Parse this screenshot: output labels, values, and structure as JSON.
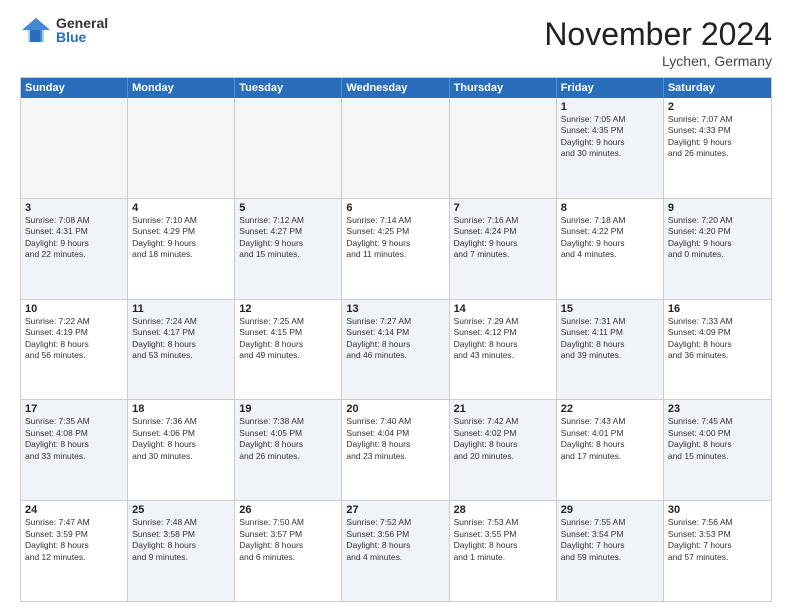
{
  "logo": {
    "general": "General",
    "blue": "Blue"
  },
  "title": "November 2024",
  "location": "Lychen, Germany",
  "days": [
    "Sunday",
    "Monday",
    "Tuesday",
    "Wednesday",
    "Thursday",
    "Friday",
    "Saturday"
  ],
  "rows": [
    [
      {
        "day": "",
        "text": "",
        "empty": true
      },
      {
        "day": "",
        "text": "",
        "empty": true
      },
      {
        "day": "",
        "text": "",
        "empty": true
      },
      {
        "day": "",
        "text": "",
        "empty": true
      },
      {
        "day": "",
        "text": "",
        "empty": true
      },
      {
        "day": "1",
        "text": "Sunrise: 7:05 AM\nSunset: 4:35 PM\nDaylight: 9 hours\nand 30 minutes.",
        "empty": false,
        "shaded": true
      },
      {
        "day": "2",
        "text": "Sunrise: 7:07 AM\nSunset: 4:33 PM\nDaylight: 9 hours\nand 26 minutes.",
        "empty": false,
        "shaded": false
      }
    ],
    [
      {
        "day": "3",
        "text": "Sunrise: 7:08 AM\nSunset: 4:31 PM\nDaylight: 9 hours\nand 22 minutes.",
        "empty": false,
        "shaded": true
      },
      {
        "day": "4",
        "text": "Sunrise: 7:10 AM\nSunset: 4:29 PM\nDaylight: 9 hours\nand 18 minutes.",
        "empty": false,
        "shaded": false
      },
      {
        "day": "5",
        "text": "Sunrise: 7:12 AM\nSunset: 4:27 PM\nDaylight: 9 hours\nand 15 minutes.",
        "empty": false,
        "shaded": true
      },
      {
        "day": "6",
        "text": "Sunrise: 7:14 AM\nSunset: 4:25 PM\nDaylight: 9 hours\nand 11 minutes.",
        "empty": false,
        "shaded": false
      },
      {
        "day": "7",
        "text": "Sunrise: 7:16 AM\nSunset: 4:24 PM\nDaylight: 9 hours\nand 7 minutes.",
        "empty": false,
        "shaded": true
      },
      {
        "day": "8",
        "text": "Sunrise: 7:18 AM\nSunset: 4:22 PM\nDaylight: 9 hours\nand 4 minutes.",
        "empty": false,
        "shaded": false
      },
      {
        "day": "9",
        "text": "Sunrise: 7:20 AM\nSunset: 4:20 PM\nDaylight: 9 hours\nand 0 minutes.",
        "empty": false,
        "shaded": true
      }
    ],
    [
      {
        "day": "10",
        "text": "Sunrise: 7:22 AM\nSunset: 4:19 PM\nDaylight: 8 hours\nand 56 minutes.",
        "empty": false,
        "shaded": false
      },
      {
        "day": "11",
        "text": "Sunrise: 7:24 AM\nSunset: 4:17 PM\nDaylight: 8 hours\nand 53 minutes.",
        "empty": false,
        "shaded": true
      },
      {
        "day": "12",
        "text": "Sunrise: 7:25 AM\nSunset: 4:15 PM\nDaylight: 8 hours\nand 49 minutes.",
        "empty": false,
        "shaded": false
      },
      {
        "day": "13",
        "text": "Sunrise: 7:27 AM\nSunset: 4:14 PM\nDaylight: 8 hours\nand 46 minutes.",
        "empty": false,
        "shaded": true
      },
      {
        "day": "14",
        "text": "Sunrise: 7:29 AM\nSunset: 4:12 PM\nDaylight: 8 hours\nand 43 minutes.",
        "empty": false,
        "shaded": false
      },
      {
        "day": "15",
        "text": "Sunrise: 7:31 AM\nSunset: 4:11 PM\nDaylight: 8 hours\nand 39 minutes.",
        "empty": false,
        "shaded": true
      },
      {
        "day": "16",
        "text": "Sunrise: 7:33 AM\nSunset: 4:09 PM\nDaylight: 8 hours\nand 36 minutes.",
        "empty": false,
        "shaded": false
      }
    ],
    [
      {
        "day": "17",
        "text": "Sunrise: 7:35 AM\nSunset: 4:08 PM\nDaylight: 8 hours\nand 33 minutes.",
        "empty": false,
        "shaded": true
      },
      {
        "day": "18",
        "text": "Sunrise: 7:36 AM\nSunset: 4:06 PM\nDaylight: 8 hours\nand 30 minutes.",
        "empty": false,
        "shaded": false
      },
      {
        "day": "19",
        "text": "Sunrise: 7:38 AM\nSunset: 4:05 PM\nDaylight: 8 hours\nand 26 minutes.",
        "empty": false,
        "shaded": true
      },
      {
        "day": "20",
        "text": "Sunrise: 7:40 AM\nSunset: 4:04 PM\nDaylight: 8 hours\nand 23 minutes.",
        "empty": false,
        "shaded": false
      },
      {
        "day": "21",
        "text": "Sunrise: 7:42 AM\nSunset: 4:02 PM\nDaylight: 8 hours\nand 20 minutes.",
        "empty": false,
        "shaded": true
      },
      {
        "day": "22",
        "text": "Sunrise: 7:43 AM\nSunset: 4:01 PM\nDaylight: 8 hours\nand 17 minutes.",
        "empty": false,
        "shaded": false
      },
      {
        "day": "23",
        "text": "Sunrise: 7:45 AM\nSunset: 4:00 PM\nDaylight: 8 hours\nand 15 minutes.",
        "empty": false,
        "shaded": true
      }
    ],
    [
      {
        "day": "24",
        "text": "Sunrise: 7:47 AM\nSunset: 3:59 PM\nDaylight: 8 hours\nand 12 minutes.",
        "empty": false,
        "shaded": false
      },
      {
        "day": "25",
        "text": "Sunrise: 7:48 AM\nSunset: 3:58 PM\nDaylight: 8 hours\nand 9 minutes.",
        "empty": false,
        "shaded": true
      },
      {
        "day": "26",
        "text": "Sunrise: 7:50 AM\nSunset: 3:57 PM\nDaylight: 8 hours\nand 6 minutes.",
        "empty": false,
        "shaded": false
      },
      {
        "day": "27",
        "text": "Sunrise: 7:52 AM\nSunset: 3:56 PM\nDaylight: 8 hours\nand 4 minutes.",
        "empty": false,
        "shaded": true
      },
      {
        "day": "28",
        "text": "Sunrise: 7:53 AM\nSunset: 3:55 PM\nDaylight: 8 hours\nand 1 minute.",
        "empty": false,
        "shaded": false
      },
      {
        "day": "29",
        "text": "Sunrise: 7:55 AM\nSunset: 3:54 PM\nDaylight: 7 hours\nand 59 minutes.",
        "empty": false,
        "shaded": true
      },
      {
        "day": "30",
        "text": "Sunrise: 7:56 AM\nSunset: 3:53 PM\nDaylight: 7 hours\nand 57 minutes.",
        "empty": false,
        "shaded": false
      }
    ]
  ]
}
